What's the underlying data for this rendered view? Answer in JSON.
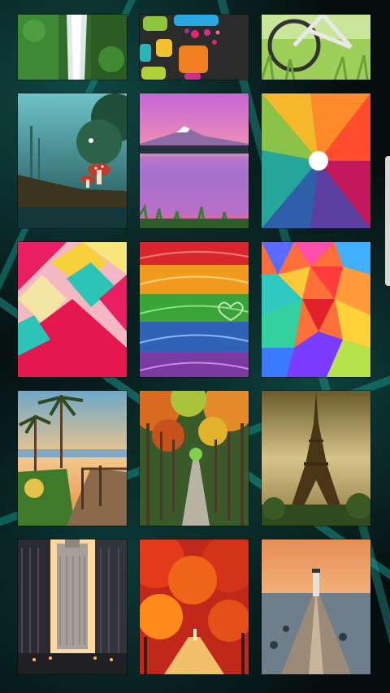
{
  "screen": {
    "title": "",
    "wallpapers": [
      {
        "name": "waterfall-forest"
      },
      {
        "name": "colorful-rounded-squares"
      },
      {
        "name": "bicycle-grass"
      },
      {
        "name": "fantasy-forest-mushrooms"
      },
      {
        "name": "mountain-lake-sunset"
      },
      {
        "name": "color-petals-burst"
      },
      {
        "name": "geometric-diamonds"
      },
      {
        "name": "rainbow-hearts-stripes"
      },
      {
        "name": "low-poly-colorful"
      },
      {
        "name": "palm-boardwalk-sunset"
      },
      {
        "name": "autumn-tree-tunnel"
      },
      {
        "name": "eiffel-tower-sepia"
      },
      {
        "name": "city-skyscrapers-night"
      },
      {
        "name": "red-autumn-trees"
      },
      {
        "name": "lighthouse-pier-dusk"
      }
    ]
  },
  "colors": {
    "background": "#050d0d",
    "accent": "#1fa89c"
  }
}
